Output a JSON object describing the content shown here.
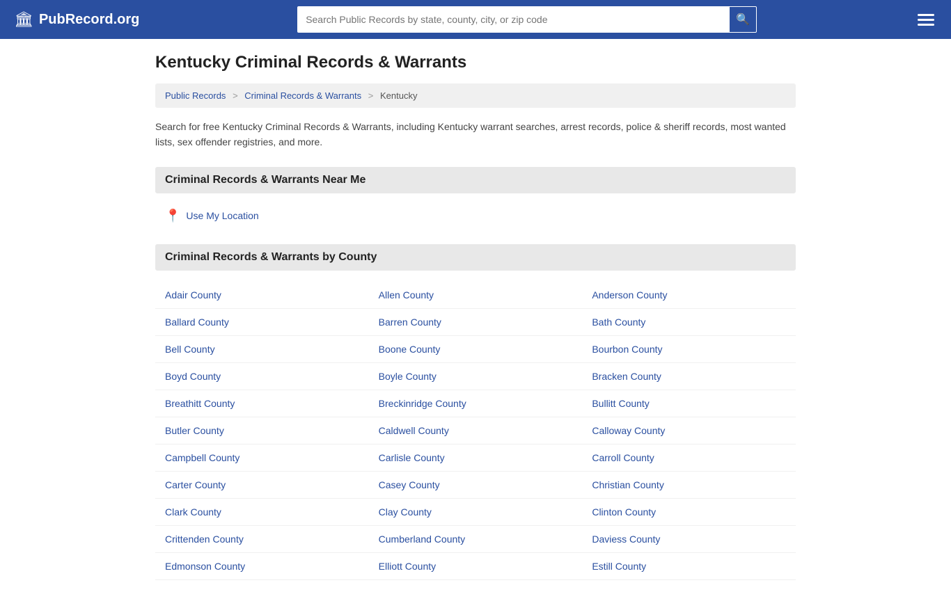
{
  "header": {
    "logo_icon": "🏛",
    "logo_text": "PubRecord.org",
    "search_placeholder": "Search Public Records by state, county, city, or zip code",
    "search_button_icon": "🔍",
    "menu_icon": "☰"
  },
  "page": {
    "title": "Kentucky Criminal Records & Warrants",
    "breadcrumb": {
      "items": [
        "Public Records",
        "Criminal Records & Warrants",
        "Kentucky"
      ],
      "separators": [
        ">",
        ">"
      ]
    },
    "description": "Search for free Kentucky Criminal Records & Warrants, including Kentucky warrant searches, arrest records, police & sheriff records, most wanted lists, sex offender registries, and more.",
    "near_me": {
      "section_title": "Criminal Records & Warrants Near Me",
      "location_label": "Use My Location"
    },
    "by_county": {
      "section_title": "Criminal Records & Warrants by County",
      "counties": [
        "Adair County",
        "Allen County",
        "Anderson County",
        "Ballard County",
        "Barren County",
        "Bath County",
        "Bell County",
        "Boone County",
        "Bourbon County",
        "Boyd County",
        "Boyle County",
        "Bracken County",
        "Breathitt County",
        "Breckinridge County",
        "Bullitt County",
        "Butler County",
        "Caldwell County",
        "Calloway County",
        "Campbell County",
        "Carlisle County",
        "Carroll County",
        "Carter County",
        "Casey County",
        "Christian County",
        "Clark County",
        "Clay County",
        "Clinton County",
        "Crittenden County",
        "Cumberland County",
        "Daviess County",
        "Edmonson County",
        "Elliott County",
        "Estill County"
      ]
    }
  },
  "breadcrumb_links": {
    "public_records": "Public Records",
    "criminal_records": "Criminal Records & Warrants",
    "kentucky": "Kentucky"
  }
}
